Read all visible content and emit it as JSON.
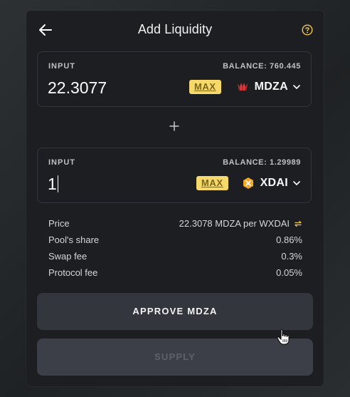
{
  "header": {
    "title": "Add Liquidity",
    "back_icon": "arrow-left-icon",
    "help_icon": "question-circle-icon"
  },
  "input_one": {
    "label": "INPUT",
    "balance": "BALANCE: 760.445",
    "value": "22.3077",
    "max_label": "MAX",
    "token": "MDZA",
    "token_icon": "mdza-token-icon"
  },
  "plus_icon": "plus-icon",
  "input_two": {
    "label": "INPUT",
    "balance": "BALANCE: 1.29989",
    "value": "1",
    "max_label": "MAX",
    "token": "XDAI",
    "token_icon": "xdai-token-icon"
  },
  "info": {
    "price_label": "Price",
    "price_value": "22.3078 MDZA per WXDAI",
    "pool_share_label": "Pool's share",
    "pool_share_value": "0.86%",
    "swap_fee_label": "Swap fee",
    "swap_fee_value": "0.3%",
    "protocol_fee_label": "Protocol fee",
    "protocol_fee_value": "0.05%"
  },
  "buttons": {
    "approve": "APPROVE MDZA",
    "supply": "SUPPLY"
  },
  "colors": {
    "background": "#1d1e22",
    "max_bg": "#f7d86b",
    "max_text": "#7a6618",
    "mdza_red": "#d93a3a",
    "xdai_orange": "#f5a623",
    "swap_icon_yellow": "#f2c94c"
  }
}
